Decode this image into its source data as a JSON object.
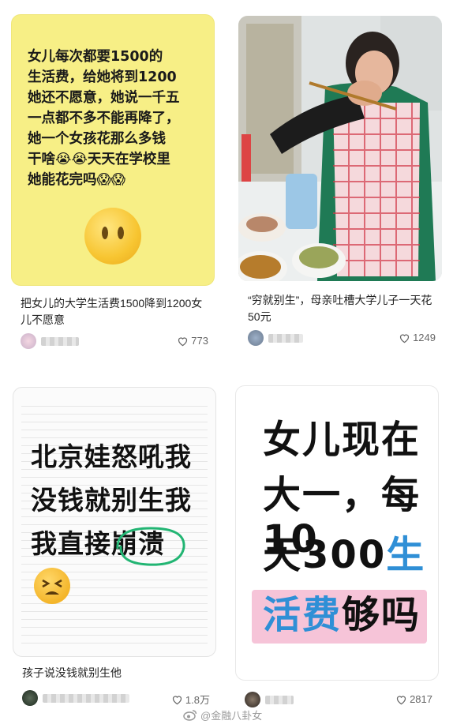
{
  "cards": [
    {
      "image_text": [
        "女儿每次都要1500的",
        "生活费，给她将到1200",
        "她还不愿意，她说一千五",
        "一点都不多不能再降了，",
        "她一个女孩花那么多钱",
        "干啥😭😭天天在学校里",
        "她能花完吗😱😱"
      ],
      "caption": "把女儿的大学生活费1500降到1200女儿不愿意",
      "likes": "773",
      "icon": "neutral-face-emoji"
    },
    {
      "caption": "“穷就别生”，母亲吐槽大学儿子一天花50元",
      "likes": "1249"
    },
    {
      "image_text": [
        "北京娃怒吼我",
        "没钱就别生我",
        "我直接崩溃"
      ],
      "caption": "孩子说没钱就别生他",
      "likes": "1.8万",
      "icon": "tired-face-emoji"
    },
    {
      "image_text": [
        "女儿现在",
        "大一，每10",
        "天300生",
        "活费够吗"
      ],
      "caption": "",
      "likes": "2817"
    }
  ],
  "colors": {
    "card1_bg": "#f7ef86",
    "highlight_green": "#22b573",
    "highlight_blue": "#2f8fd6",
    "highlight_pink": "#f6c4d8"
  },
  "watermark": "@金融八卦女"
}
